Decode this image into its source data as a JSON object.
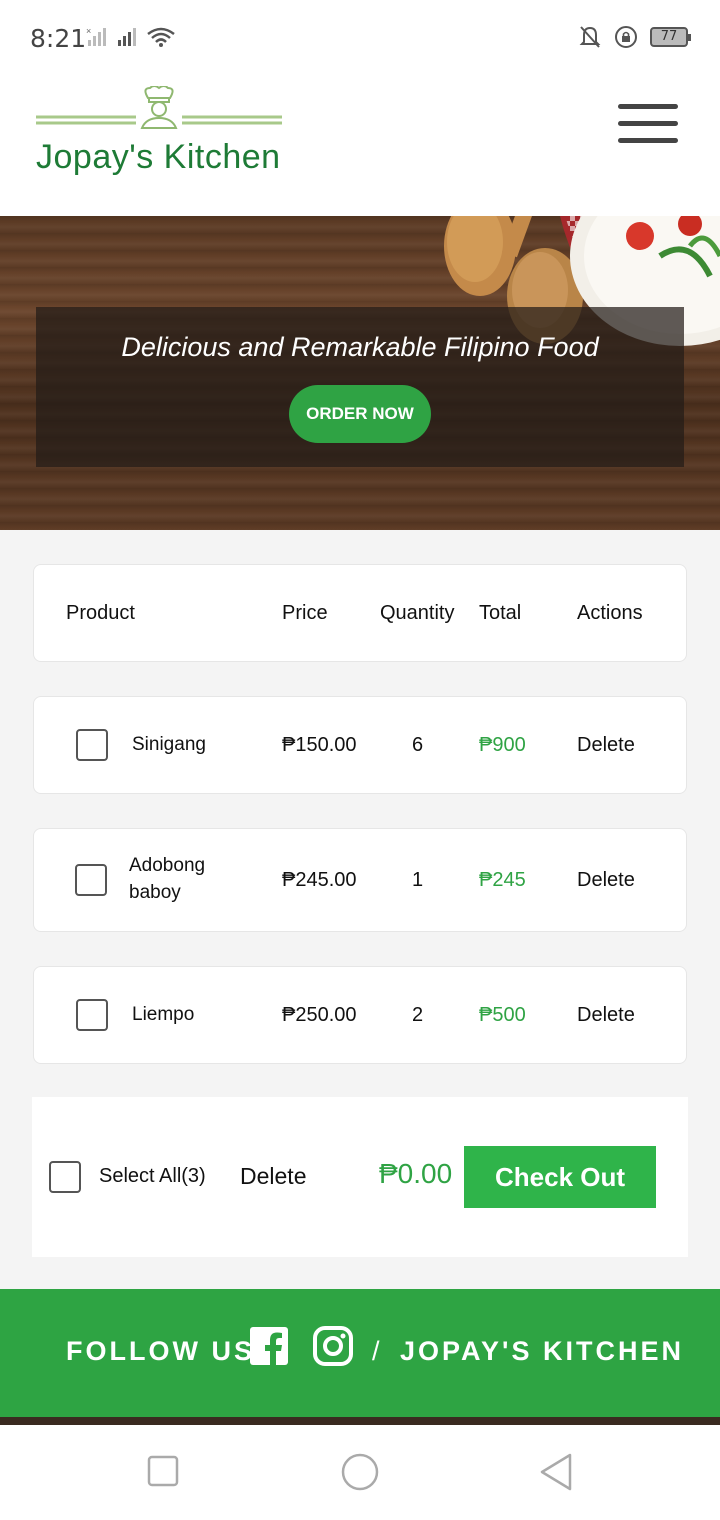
{
  "status_bar": {
    "time": "8:21",
    "battery": "77"
  },
  "header": {
    "brand": "Jopay's Kitchen"
  },
  "hero": {
    "tagline": "Delicious and Remarkable Filipino Food",
    "order_button": "ORDER NOW"
  },
  "cart": {
    "headers": {
      "product": "Product",
      "price": "Price",
      "quantity": "Quantity",
      "total": "Total",
      "actions": "Actions"
    },
    "rows": [
      {
        "product": "Sinigang",
        "price": "₱150.00",
        "quantity": "6",
        "total": "₱900",
        "action": "Delete"
      },
      {
        "product_line1": "Adobong",
        "product_line2": "baboy",
        "price": "₱245.00",
        "quantity": "1",
        "total": "₱245",
        "action": "Delete"
      },
      {
        "product": "Liempo",
        "price": "₱250.00",
        "quantity": "2",
        "total": "₱500",
        "action": "Delete"
      }
    ],
    "footer": {
      "select_all": "Select All(3)",
      "delete": "Delete",
      "grand_total": "₱0.00",
      "checkout": "Check Out"
    }
  },
  "follow": {
    "label": "FOLLOW US",
    "separator": "/",
    "name": "JOPAY'S KITCHEN"
  },
  "colors": {
    "accent": "#2fa344",
    "brand_text": "#1e7b36"
  }
}
